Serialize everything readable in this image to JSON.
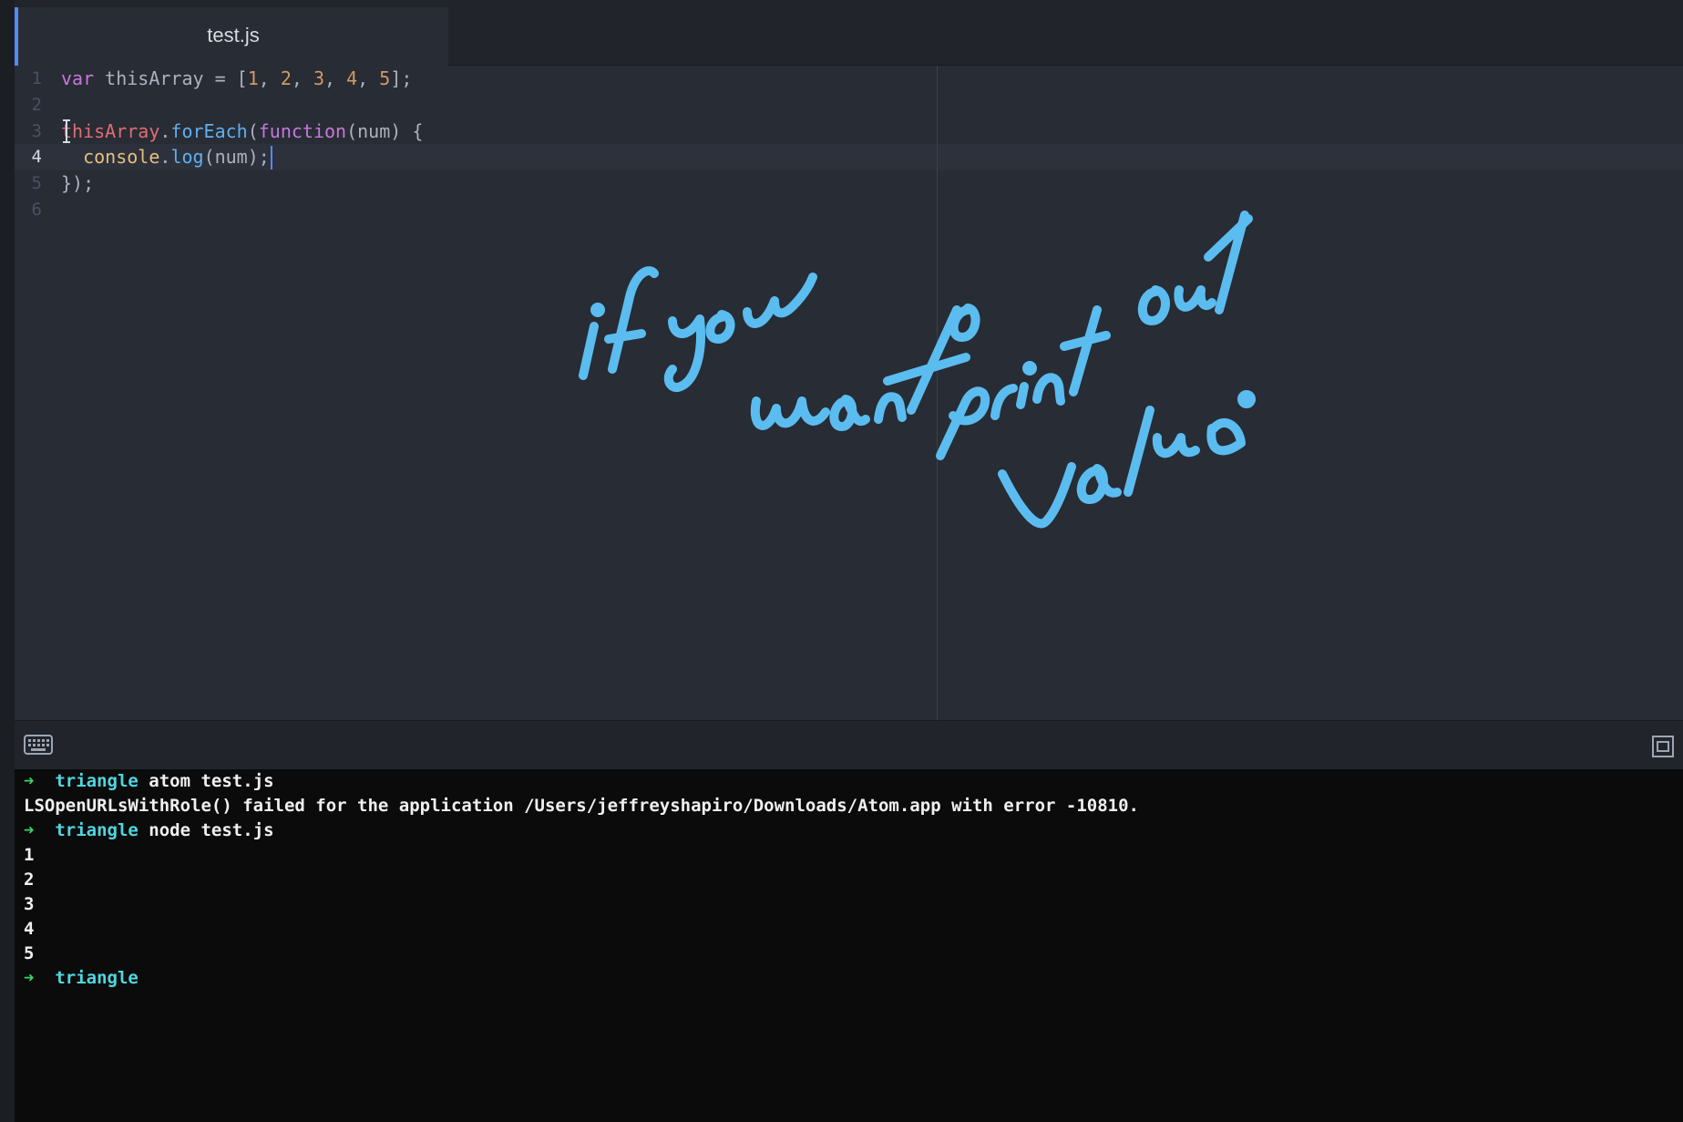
{
  "editor": {
    "tab_title": "test.js",
    "line_numbers": [
      "1",
      "2",
      "3",
      "4",
      "5",
      "6"
    ],
    "active_line": 4,
    "code": {
      "l1": {
        "t1": "var",
        "t2": " thisArray = [",
        "t3": "1",
        "t4": ", ",
        "t5": "2",
        "t6": ", ",
        "t7": "3",
        "t8": ", ",
        "t9": "4",
        "t10": ", ",
        "t11": "5",
        "t12": "];"
      },
      "l3": {
        "t1": "thisArray",
        "t2": ".",
        "t3": "forEach",
        "t4": "(",
        "t5": "function",
        "t6": "(num) {"
      },
      "l4": {
        "t0": "  ",
        "t1": "console",
        "t2": ".",
        "t3": "log",
        "t4": "(num);"
      },
      "l5": {
        "t1": "});"
      }
    }
  },
  "annotation": {
    "text": "if you want to print out value.",
    "color": "#5bbcf0"
  },
  "terminal": {
    "lines": [
      {
        "arrow": "➜",
        "host": "triangle",
        "cmd": " atom test.js"
      },
      {
        "text": "LSOpenURLsWithRole() failed for the application /Users/jeffreyshapiro/Downloads/Atom.app with error -10810."
      },
      {
        "arrow": "➜",
        "host": "triangle",
        "cmd": " node test.js"
      },
      {
        "text": "1"
      },
      {
        "text": "2"
      },
      {
        "text": "3"
      },
      {
        "text": "4"
      },
      {
        "text": "5"
      },
      {
        "arrow": "➜",
        "host": "triangle",
        "cmd": ""
      }
    ]
  },
  "icons": {
    "keyboard": "keyboard-icon",
    "maximize": "maximize-icon",
    "cursor": "text-cursor-icon"
  },
  "colors": {
    "keyword": "#c678dd",
    "number": "#d19a66",
    "variable": "#e06c75",
    "function": "#61afef",
    "object": "#e5c07b",
    "prompt_arrow": "#3ad36b",
    "prompt_host": "#4fd6e0"
  }
}
